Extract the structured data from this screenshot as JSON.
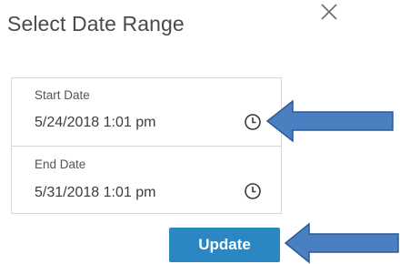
{
  "dialog": {
    "title": "Select Date Range",
    "close_icon": "close-icon"
  },
  "start": {
    "label": "Start Date",
    "value": "5/24/2018 1:01 pm",
    "icon": "clock-icon"
  },
  "end": {
    "label": "End Date",
    "value": "5/31/2018 1:01 pm",
    "icon": "clock-icon"
  },
  "actions": {
    "update_label": "Update",
    "update_color": "#2a87c1"
  },
  "annotations": {
    "arrow_color": "#4a7fc1",
    "arrow_icon": "left-pointing-arrow"
  }
}
